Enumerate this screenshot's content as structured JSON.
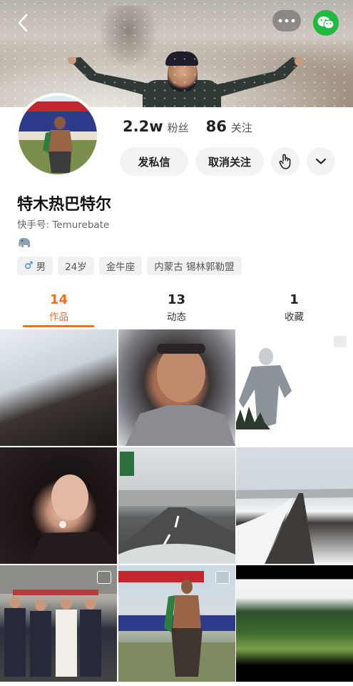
{
  "profile": {
    "followers_value": "2.2w",
    "followers_label": "粉丝",
    "following_value": "86",
    "following_label": "关注",
    "message_button": "发私信",
    "unfollow_button": "取消关注",
    "name": "特木热巴特尔",
    "kuaishou_id": "快手号: Temurebate",
    "tags": {
      "gender_symbol": "♂",
      "gender": "男",
      "age": "24岁",
      "zodiac": "金牛座",
      "location": "内蒙古 锡林郭勒盟"
    }
  },
  "tabs": [
    {
      "count": "14",
      "label": "作品"
    },
    {
      "count": "13",
      "label": "动态"
    },
    {
      "count": "1",
      "label": "收藏"
    }
  ],
  "icons": {
    "back": "back-arrow-icon",
    "more": "more-dots-icon",
    "share": "wechat-icon",
    "gesture": "hand-pointer-icon",
    "expand": "chevron-down-icon",
    "emoji": "elephant-icon"
  },
  "colors": {
    "accent": "#ff6a1a",
    "wechat": "#1fbb3f",
    "male": "#2f7de1"
  }
}
